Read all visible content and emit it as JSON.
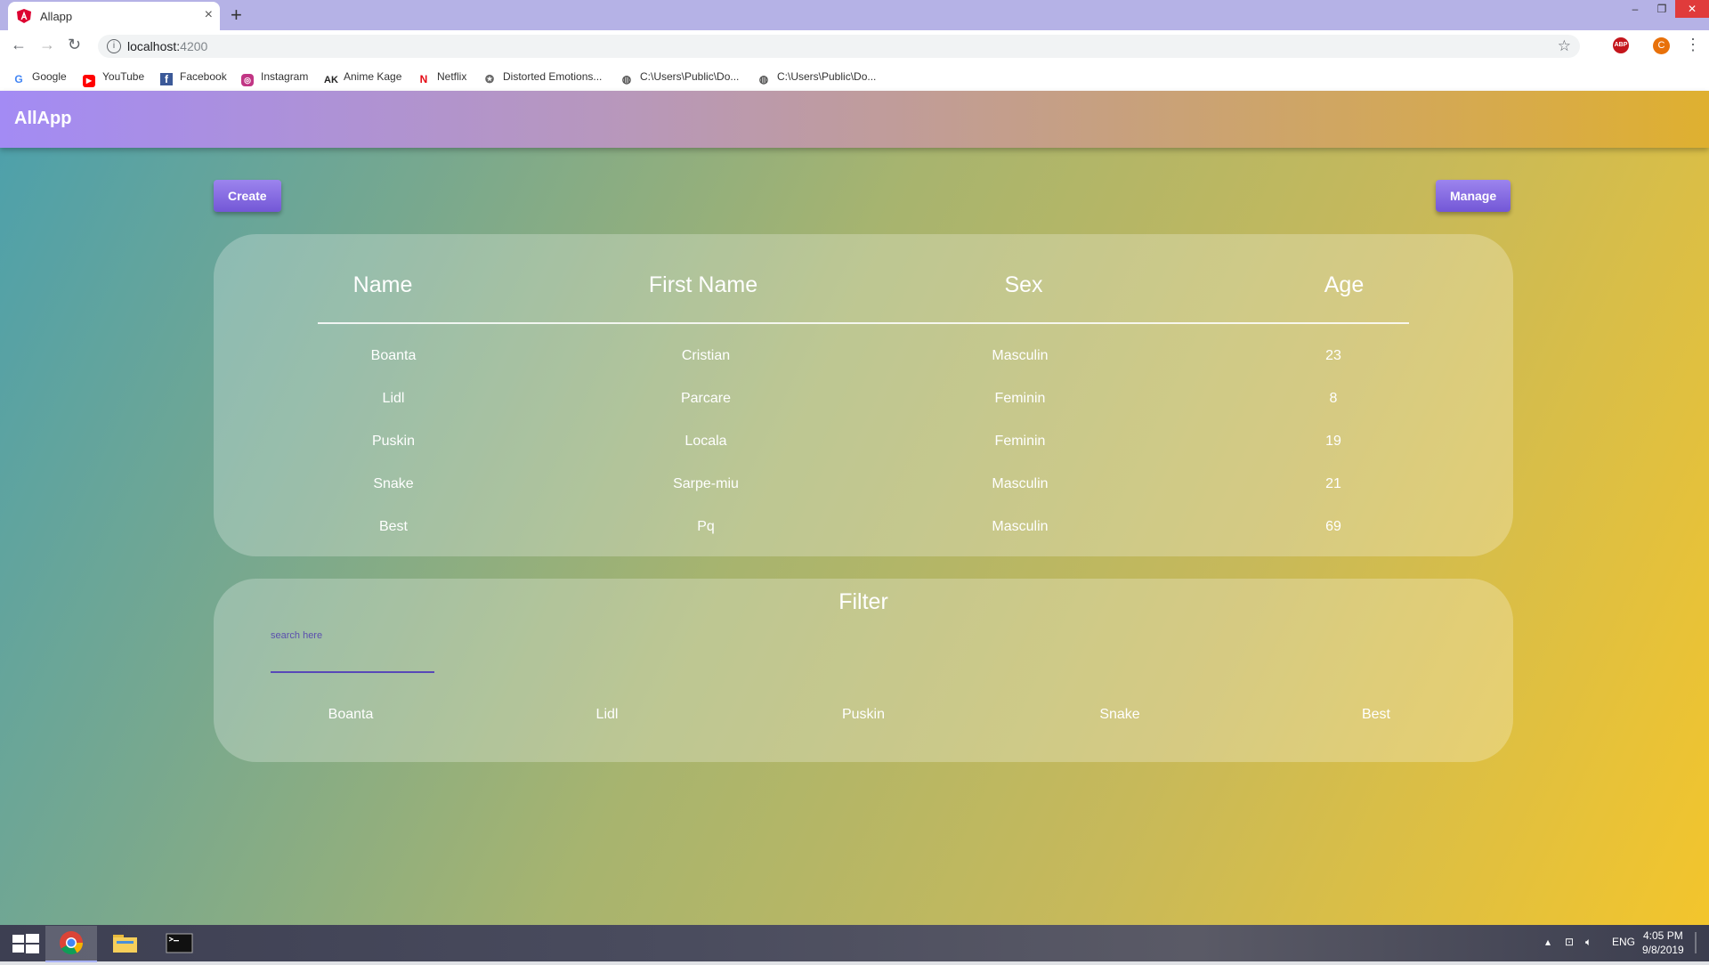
{
  "browser": {
    "tab_title": "Allapp",
    "url_host": "localhost:",
    "url_port": "4200",
    "bookmarks": [
      {
        "label": "Google",
        "icon": "google-icon"
      },
      {
        "label": "YouTube",
        "icon": "youtube-icon"
      },
      {
        "label": "Facebook",
        "icon": "facebook-icon"
      },
      {
        "label": "Instagram",
        "icon": "instagram-icon"
      },
      {
        "label": "Anime Kage",
        "icon": "animekage-icon"
      },
      {
        "label": "Netflix",
        "icon": "netflix-icon"
      },
      {
        "label": "Distorted Emotions...",
        "icon": "distorted-emotions-icon"
      },
      {
        "label": "C:\\Users\\Public\\Do...",
        "icon": "globe-icon"
      },
      {
        "label": "C:\\Users\\Public\\Do...",
        "icon": "globe-icon"
      }
    ],
    "profile_initial": "C",
    "extension_label": "ABP"
  },
  "app": {
    "title": "AllApp",
    "create_label": "Create",
    "manage_label": "Manage",
    "table": {
      "headers": [
        "Name",
        "First Name",
        "Sex",
        "Age"
      ],
      "rows": [
        [
          "Boanta",
          "Cristian",
          "Masculin",
          "23"
        ],
        [
          "Lidl",
          "Parcare",
          "Feminin",
          "8"
        ],
        [
          "Puskin",
          "Locala",
          "Feminin",
          "19"
        ],
        [
          "Snake",
          "Sarpe-miu",
          "Masculin",
          "21"
        ],
        [
          "Best",
          "Pq",
          "Masculin",
          "69"
        ]
      ]
    },
    "filter": {
      "title": "Filter",
      "search_placeholder": "search here",
      "search_value": "",
      "results": [
        "Boanta",
        "Lidl",
        "Puskin",
        "Snake",
        "Best"
      ]
    }
  },
  "taskbar": {
    "language": "ENG",
    "time": "4:05 PM",
    "date": "9/8/2019"
  },
  "colors": {
    "accent": "#7a5fe0",
    "appbar_start": "#a38bf4",
    "appbar_end": "#dfb030",
    "page_start": "#4ca0ac",
    "page_end": "#f3c52c"
  }
}
